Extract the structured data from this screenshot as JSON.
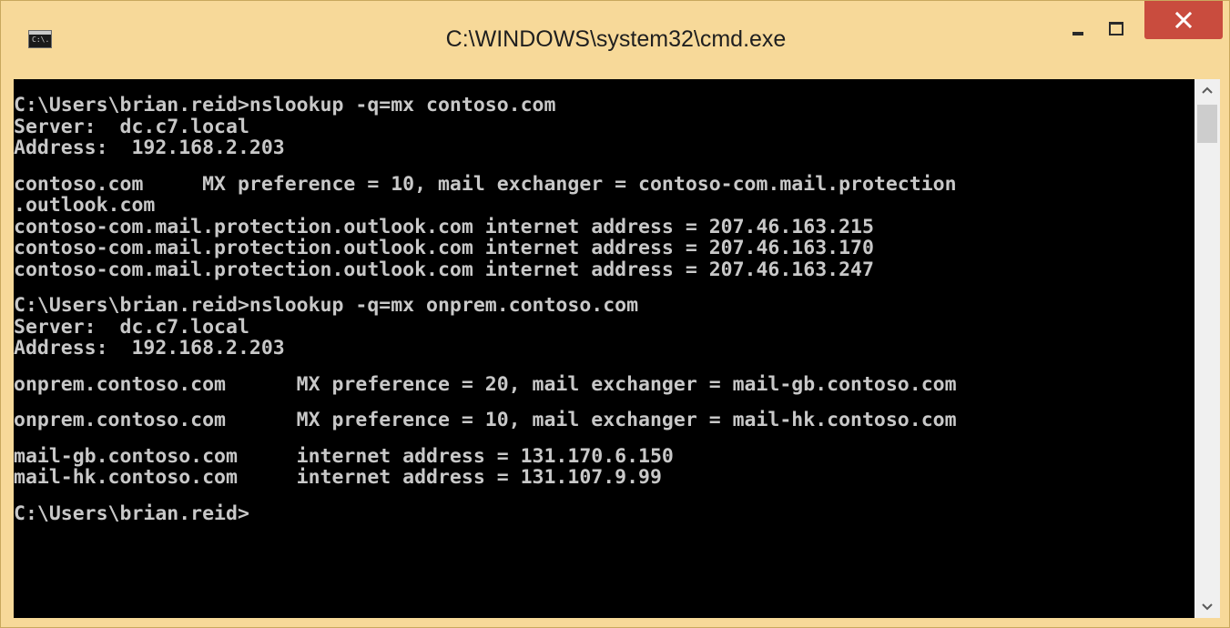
{
  "window": {
    "title": "C:\\WINDOWS\\system32\\cmd.exe",
    "icon": "cmd-icon",
    "icon_text": "C:\\.",
    "controls": [
      "minimize-icon",
      "maximize-icon",
      "close-icon"
    ]
  },
  "console": {
    "lines": [
      "C:\\Users\\brian.reid>nslookup -q=mx contoso.com",
      "Server:  dc.c7.local",
      "Address:  192.168.2.203",
      "",
      "contoso.com     MX preference = 10, mail exchanger = contoso-com.mail.protection",
      ".outlook.com",
      "contoso-com.mail.protection.outlook.com internet address = 207.46.163.215",
      "contoso-com.mail.protection.outlook.com internet address = 207.46.163.170",
      "contoso-com.mail.protection.outlook.com internet address = 207.46.163.247",
      "",
      "C:\\Users\\brian.reid>nslookup -q=mx onprem.contoso.com",
      "Server:  dc.c7.local",
      "Address:  192.168.2.203",
      "",
      "onprem.contoso.com      MX preference = 20, mail exchanger = mail-gb.contoso.com",
      "",
      "onprem.contoso.com      MX preference = 10, mail exchanger = mail-hk.contoso.com",
      "",
      "mail-gb.contoso.com     internet address = 131.170.6.150",
      "mail-hk.contoso.com     internet address = 131.107.9.99",
      "",
      "C:\\Users\\brian.reid>"
    ]
  },
  "colors": {
    "frame": "#f7d999",
    "console_bg": "#000000",
    "console_text": "#c8c8c8",
    "close_button": "#c94c3e"
  },
  "scrollbar": {
    "up_icon": "chevron-up-icon",
    "down_icon": "chevron-down-icon"
  }
}
